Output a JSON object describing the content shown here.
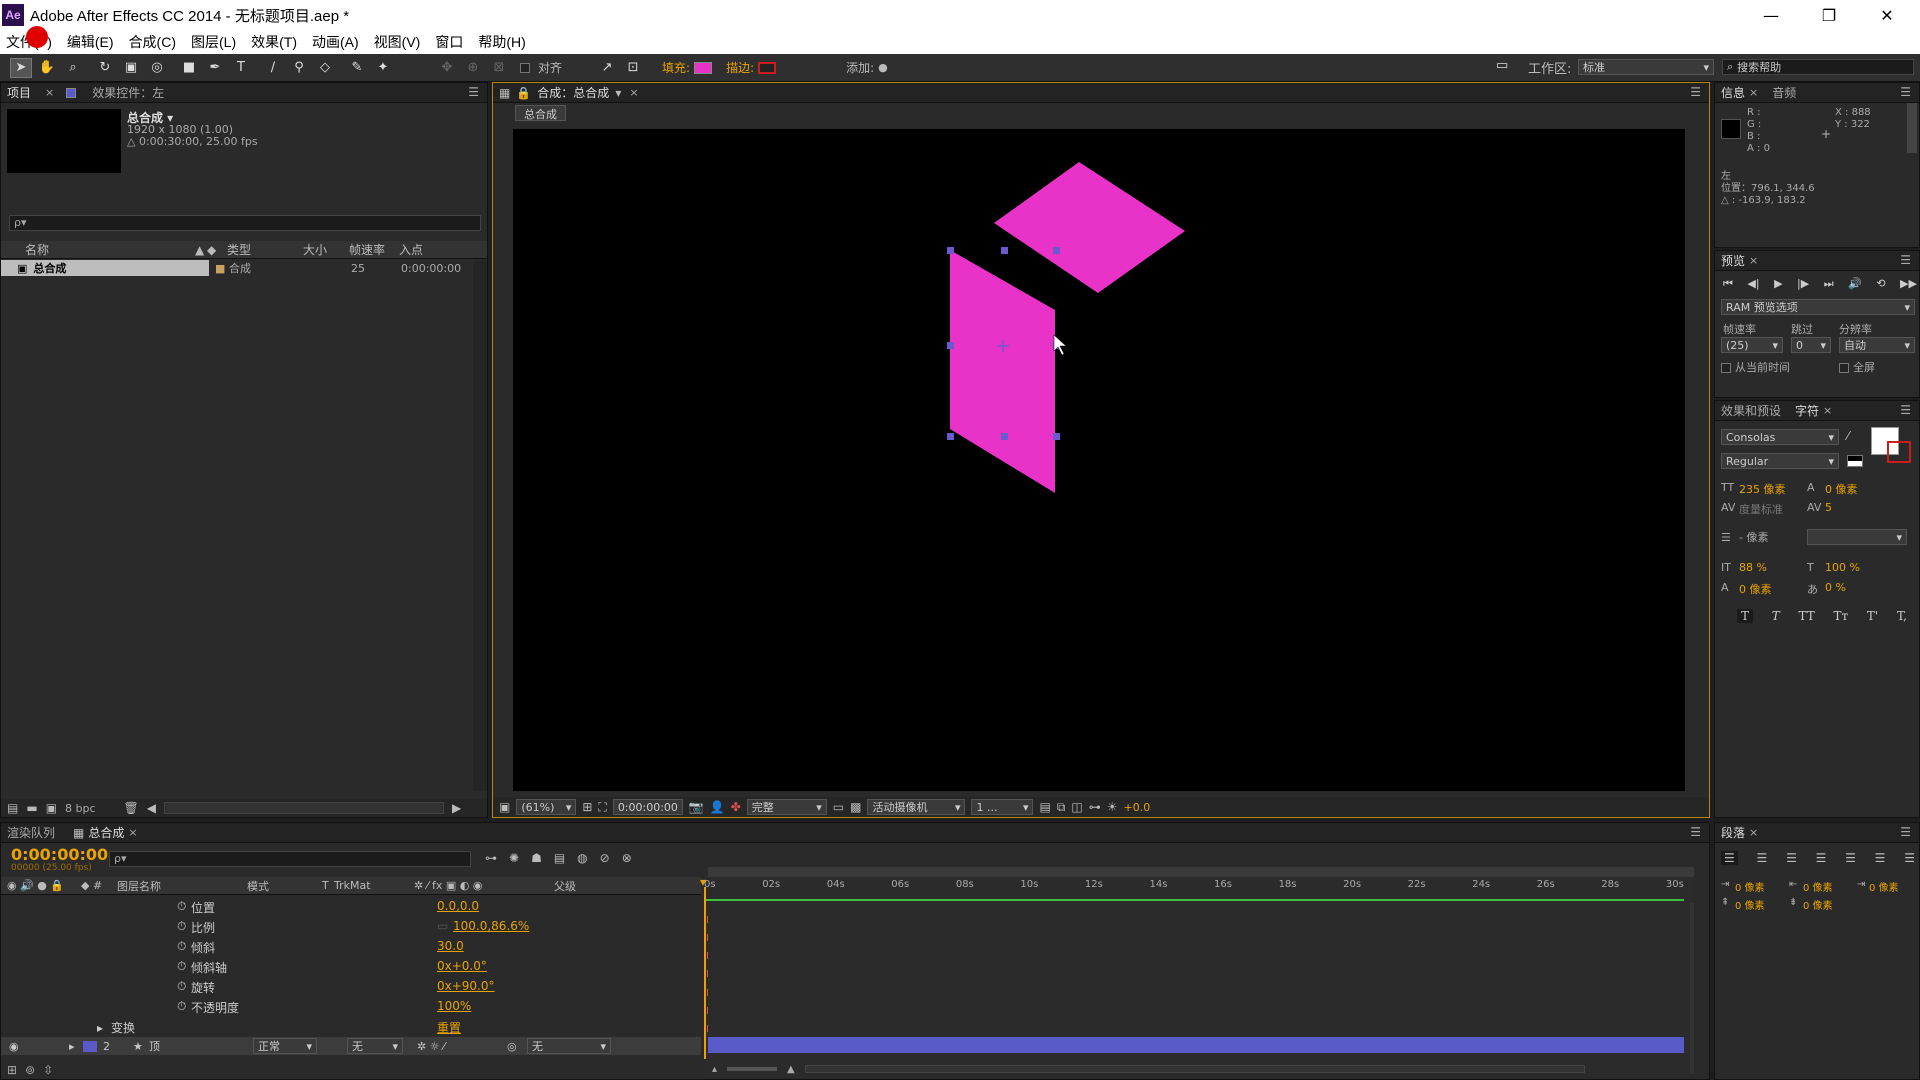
{
  "window": {
    "app_icon": "Ae",
    "title": "Adobe After Effects CC 2014 - 无标题项目.aep *",
    "min": "—",
    "restore": "❐",
    "close": "✕"
  },
  "menu": [
    "文件(F)",
    "编辑(E)",
    "合成(C)",
    "图层(L)",
    "效果(T)",
    "动画(A)",
    "视图(V)",
    "窗口",
    "帮助(H)"
  ],
  "toolbar": {
    "align_label": "对齐",
    "fill_label": "填充:",
    "stroke_label": "描边:",
    "add_label": "添加:",
    "workspace_label": "工作区:",
    "workspace_value": "标准",
    "search_placeholder": "搜索帮助",
    "fill_color": "#e832c8",
    "stroke_color": "#c81e1e"
  },
  "project": {
    "tab_project": "项目",
    "tab_effects": "效果控件：左",
    "comp_name": "总合成 ▾",
    "comp_dims": "1920 x 1080 (1.00)",
    "comp_duration": "△ 0:00:30:00, 25.00 fps",
    "search_placeholder": "ρ▾",
    "columns": [
      "名称",
      "类型",
      "大小",
      "帧速率",
      "入点"
    ],
    "rows": [
      {
        "name": "总合成",
        "type": "合成",
        "size": "",
        "fps": "25",
        "in": "0:00:00:00"
      }
    ],
    "bpc": "8 bpc"
  },
  "composition": {
    "tab_title": "合成：总合成",
    "breadcrumb": "总合成",
    "zoom": "(61%)",
    "timecode": "0:00:00:00",
    "quality": "完整",
    "camera": "活动摄像机",
    "views": "1 ...",
    "exposure": "+0.0",
    "shape_color": "#e832c8"
  },
  "info": {
    "tab_info": "信息",
    "tab_audio": "音频",
    "rgba": [
      "R :",
      "G :",
      "B :",
      "A : 0"
    ],
    "x": "X : 888",
    "y": "Y : 322",
    "layer": "左",
    "position": "位置：796.1, 344.6",
    "delta": "△ : -163.9, 183.2"
  },
  "preview": {
    "tab": "预览",
    "ram_options": "RAM 预览选项",
    "fps_label": "帧速率",
    "skip_label": "跳过",
    "res_label": "分辨率",
    "fps_value": "(25)",
    "skip_value": "0",
    "res_value": "自动",
    "from_current": "从当前时间",
    "fullscreen": "全屏"
  },
  "character": {
    "tab_effects": "效果和预设",
    "tab_char": "字符",
    "font": "Consolas",
    "style": "Regular",
    "size": "235 像素",
    "leading": "0 像素",
    "kerning": "度量标准",
    "tracking": "5",
    "stroke_width": "- 像素",
    "vscale": "88 %",
    "hscale": "100 %",
    "baseline": "0 像素",
    "tsume": "0 %",
    "styles": [
      "T",
      "T",
      "TT",
      "Tт",
      "T'",
      "T,"
    ]
  },
  "paragraph": {
    "tab": "段落",
    "indent_left": "0 像素",
    "indent_right": "0 像素",
    "indent_first": "0 像素",
    "space_before": "0 像素",
    "space_after": "0 像素"
  },
  "timeline": {
    "tab_render": "渲染队列",
    "tab_comp": "总合成",
    "timecode": "0:00:00:00",
    "frame_info": "00000 (25.00 fps)",
    "search_placeholder": "ρ▾",
    "col_layer_name": "图层名称",
    "col_mode": "模式",
    "col_t": "T",
    "col_trkmat": "TrkMat",
    "col_parent": "父级",
    "ruler": [
      "0s",
      "02s",
      "04s",
      "06s",
      "08s",
      "10s",
      "12s",
      "14s",
      "16s",
      "18s",
      "20s",
      "22s",
      "24s",
      "26s",
      "28s",
      "30s"
    ],
    "properties": [
      {
        "name": "位置",
        "value": "0.0,0.0"
      },
      {
        "name": "比例",
        "value": "100.0,86.6%"
      },
      {
        "name": "倾斜",
        "value": "30.0"
      },
      {
        "name": "倾斜轴",
        "value": "0x+0.0°"
      },
      {
        "name": "旋转",
        "value": "0x+90.0°"
      },
      {
        "name": "不透明度",
        "value": "100%"
      }
    ],
    "transform_label": "变换",
    "reset_label": "重置",
    "layer_num": "2",
    "layer_name": "顶",
    "layer_mode": "正常",
    "layer_trkmat": "无",
    "layer_parent": "无",
    "layer_bar_color": "#5a5ac8"
  }
}
